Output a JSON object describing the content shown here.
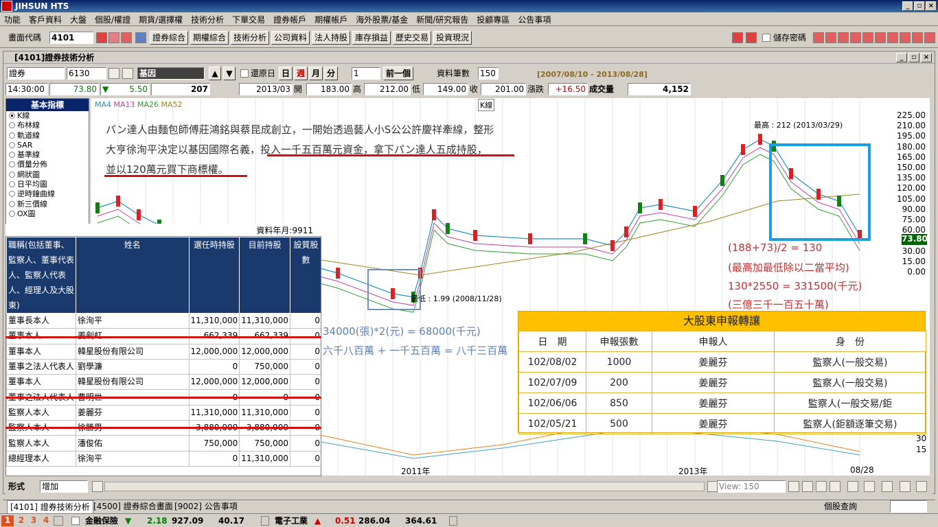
{
  "app": {
    "title": "JIHSUN HTS"
  },
  "menu": [
    "功能",
    "客戶資料",
    "大盤",
    "個股/權證",
    "期貨/選擇權",
    "技術分析",
    "下單交易",
    "證券帳戶",
    "期權帳戶",
    "海外股票/基金",
    "新聞/研究報告",
    "投顧專區",
    "公告事項"
  ],
  "toolbar": {
    "code_label": "畫面代碼",
    "code_value": "4101",
    "buttons": [
      "證券綜合",
      "期權綜合",
      "技術分析",
      "公司資料",
      "法人持股",
      "庫存損益",
      "歷史交易",
      "投資現況"
    ],
    "save_pw": "儲存密碼"
  },
  "window": {
    "title": "[4101]證券技術分析"
  },
  "query": {
    "market": "證券",
    "code": "6130",
    "name": "基因",
    "reset_label": "還原日",
    "periods": [
      "日",
      "週",
      "月",
      "分"
    ],
    "interval": "1",
    "prev_btn": "前一個",
    "count_label": "資料筆數",
    "count_value": "150",
    "range": "[2007/08/10 - 2013/08/28]"
  },
  "quote": {
    "time": "14:30:00",
    "price": "73.80",
    "change": "5.50",
    "vol": "207",
    "month": "2013/03",
    "open_l": "開",
    "open": "183.00",
    "high_l": "高",
    "high": "212.00",
    "low_l": "低",
    "low": "149.00",
    "close_l": "收",
    "close": "201.00",
    "chg_l": "漲跌",
    "chg": "+16.50",
    "total_l": "成交量",
    "total": "4,152"
  },
  "indicators": {
    "header": "基本指標",
    "items": [
      "K線",
      "布林線",
      "軌道線",
      "SAR",
      "基準線",
      "價量分佈",
      "網狀圖",
      "日平均圖",
      "逆時鐘曲線",
      "新三價線",
      "OX圖"
    ],
    "selected": 0
  },
  "chart": {
    "ma": [
      {
        "name": "MA4",
        "color": "#2090c0"
      },
      {
        "name": "MA13",
        "color": "#c040a0"
      },
      {
        "name": "MA26",
        "color": "#30a030"
      },
      {
        "name": "MA52",
        "color": "#a08020"
      }
    ],
    "kline_label": "K線",
    "high_label": "最高 : 212 (2013/03/29)",
    "low_label": "最低 : 1.99 (2008/11/28)",
    "x_labels": [
      "2011年",
      "2013年",
      "08/28"
    ],
    "y_ticks": [
      "225.00",
      "210.00",
      "195.00",
      "180.00",
      "165.00",
      "150.00",
      "135.00",
      "120.00",
      "105.00",
      "90.00",
      "75.00",
      "60.00",
      "45.00",
      "30.00",
      "15.00",
      "0.00"
    ],
    "last_price": "73.80",
    "vol_ticks": [
      "30",
      "15"
    ],
    "view_label": "View: 150",
    "form_label": "形式",
    "form_value": "增加"
  },
  "annotations": {
    "para1": "パン達人由麵包師傅莊鴻銘與蔡昆成創立，一開始透過藝人小S公公許慶祥牽線，整形",
    "para2a": "大亨徐洵平決定以基因國際名義，",
    "para2b": "投入一千五百萬元資金，拿下パン達人五成持股，",
    "para3": "並以120萬元買下商標權。",
    "calc1": "(188+73)/2 = 130",
    "calc2": "(最高加最低除以二當平均)",
    "calc3": "130*2550 = 331500(千元)",
    "calc4": "(三億三千一百五十萬)",
    "calc5": "34000(張)*2(元) = 68000(千元)",
    "calc6": "六千八百萬 + 一千五百萬 = 八千三百萬"
  },
  "shareholders": {
    "date_label": "資料年月:9911",
    "headers": [
      "職稱(包括董事、監察人、董事代表人、監察人代表人、經理人及大股東)",
      "姓名",
      "選任時持股",
      "目前持股",
      "設質股數"
    ],
    "rows": [
      [
        "董事長本人",
        "徐洵平",
        "11,310,000",
        "11,310,000",
        "0"
      ],
      [
        "董事本人",
        "姜劍虹",
        "662,339",
        "662,339",
        "0"
      ],
      [
        "董事本人",
        "韓星股份有限公司",
        "12,000,000",
        "12,000,000",
        "0"
      ],
      [
        "董事之法人代表人",
        "劉學濂",
        "0",
        "750,000",
        "0"
      ],
      [
        "董事本人",
        "韓星股份有限公司",
        "12,000,000",
        "12,000,000",
        "0"
      ],
      [
        "董事之法人代表人",
        "曹明世",
        "0",
        "0",
        "0"
      ],
      [
        "監察人本人",
        "姜麗芬",
        "11,310,000",
        "11,310,000",
        "0"
      ],
      [
        "監察人本人",
        "徐勝男",
        "3,880,000",
        "3,880,000",
        "0"
      ],
      [
        "監察人本人",
        "潘俊佑",
        "750,000",
        "750,000",
        "0"
      ],
      [
        "總經理本人",
        "徐洵平",
        "0",
        "11,310,000",
        "0"
      ]
    ]
  },
  "transfer": {
    "title": "大股東申報轉讓",
    "headers": [
      "日　期",
      "申報張數",
      "申報人",
      "身　份"
    ],
    "rows": [
      [
        "102/08/02",
        "1000",
        "姜麗芬",
        "監察人(一般交易)"
      ],
      [
        "102/07/09",
        "200",
        "姜麗芬",
        "監察人(一般交易)"
      ],
      [
        "102/06/06",
        "850",
        "姜麗芬",
        "監察人(一般交易/鉅"
      ],
      [
        "102/05/21",
        "500",
        "姜麗芬",
        "監察人(鉅額逐筆交易)"
      ]
    ]
  },
  "tabs": [
    "[4101] 證券技術分析",
    "[4500] 證券綜合畫面",
    "[9002] 公告事項"
  ],
  "status": {
    "pages": [
      "1",
      "2",
      "3",
      "4"
    ],
    "s1_name": "金融保險",
    "s1_chg": "2.18",
    "s1_idx": "927.09",
    "s1_v": "40.17",
    "s2_name": "電子工業",
    "s2_chg": "0.51",
    "s2_idx": "286.04",
    "s2_v": "364.61",
    "right": "個股查詢"
  }
}
